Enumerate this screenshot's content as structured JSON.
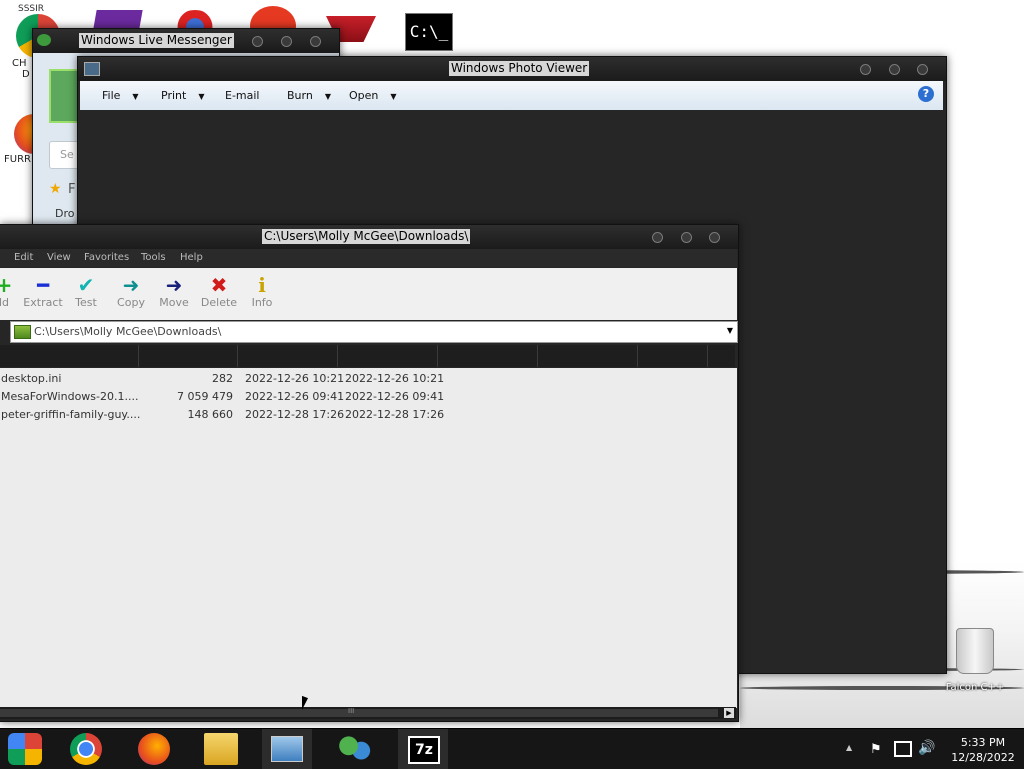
{
  "desktop": {
    "icons": [
      {
        "label": "SSSIR",
        "name": "chrome-desktop-icon"
      },
      {
        "label": "CH",
        "name": "chrome-shortcut-icon"
      },
      {
        "label": "D",
        "name": "desktop-shortcut-d"
      },
      {
        "label": "FURR",
        "name": "firefox-shortcut-icon"
      },
      {
        "label": "Falcon C++",
        "name": "falcon-cpp-icon"
      }
    ],
    "recycle_label": "Falcon C++"
  },
  "messenger": {
    "title": "Windows Live Messenger",
    "search_placeholder": "Se",
    "fav_text": "F",
    "drop_text": "Dro"
  },
  "photo_viewer": {
    "title": "Windows Photo Viewer",
    "menu": [
      "File",
      "Print",
      "E-mail",
      "Burn",
      "Open"
    ],
    "help_glyph": "?"
  },
  "zip": {
    "title": "C:\\Users\\Molly McGee\\Downloads\\",
    "menu": [
      "Edit",
      "View",
      "Favorites",
      "Tools",
      "Help"
    ],
    "toolbar": [
      {
        "label": "ld",
        "glyph": "+",
        "color": "#1fae1f"
      },
      {
        "label": "Extract",
        "glyph": "━",
        "color": "#1b2fd6"
      },
      {
        "label": "Test",
        "glyph": "✔",
        "color": "#12b3b3"
      },
      {
        "label": "Copy",
        "glyph": "➜",
        "color": "#0f8f8f"
      },
      {
        "label": "Move",
        "glyph": "➜",
        "color": "#18207a"
      },
      {
        "label": "Delete",
        "glyph": "✖",
        "color": "#d11a1a"
      },
      {
        "label": "Info",
        "glyph": "i",
        "color": "#c9a400"
      }
    ],
    "address": "C:\\Users\\Molly McGee\\Downloads\\",
    "rows": [
      {
        "name": "desktop.ini",
        "size": "282",
        "modified": "2022-12-26 10:21",
        "created": "2022-12-26 10:21"
      },
      {
        "name": "MesaForWindows-20.1....",
        "size": "7 059 479",
        "modified": "2022-12-26 09:41",
        "created": "2022-12-26 09:41"
      },
      {
        "name": "peter-griffin-family-guy....",
        "size": "148 660",
        "modified": "2022-12-28 17:26",
        "created": "2022-12-28 17:26"
      }
    ],
    "scroll_glyph": "III"
  },
  "taskbar": {
    "time": "5:33 PM",
    "date": "12/28/2022",
    "tray_up": "▲"
  }
}
